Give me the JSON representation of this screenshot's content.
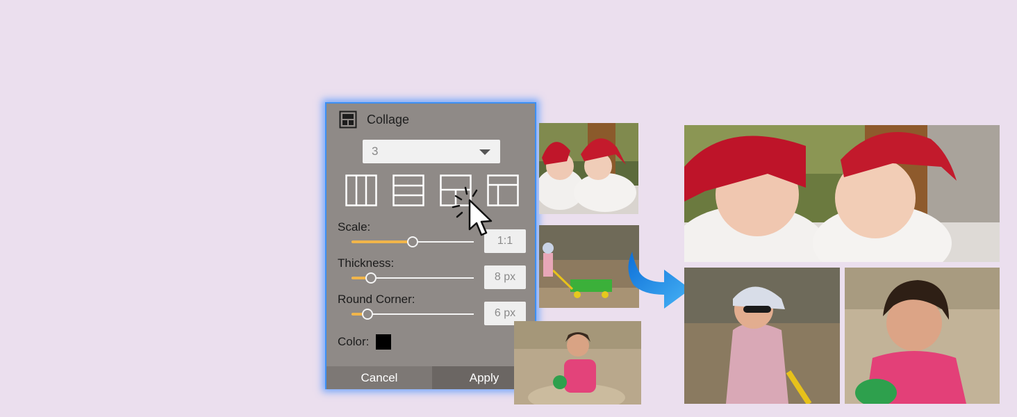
{
  "panel": {
    "title": "Collage",
    "count_value": "3",
    "layout_icons": [
      "three-columns-icon",
      "three-rows-icon",
      "one-top-two-bottom-icon",
      "one-left-two-right-icon"
    ],
    "sliders": [
      {
        "label": "Scale:",
        "value": "1:1",
        "level": 0.5
      },
      {
        "label": "Thickness:",
        "value": "8 px",
        "level": 0.16
      },
      {
        "label": "Round Corner:",
        "value": "6 px",
        "level": 0.13
      }
    ],
    "color_label": "Color:",
    "color_value": "#000000",
    "cancel_label": "Cancel",
    "apply_label": "Apply"
  },
  "colors": {
    "background": "#ebdfee",
    "panel": "#8f8a87",
    "accent": "#3d8ff2",
    "slider_fill": "#f0b54a",
    "arrow": "#2f9bec"
  }
}
